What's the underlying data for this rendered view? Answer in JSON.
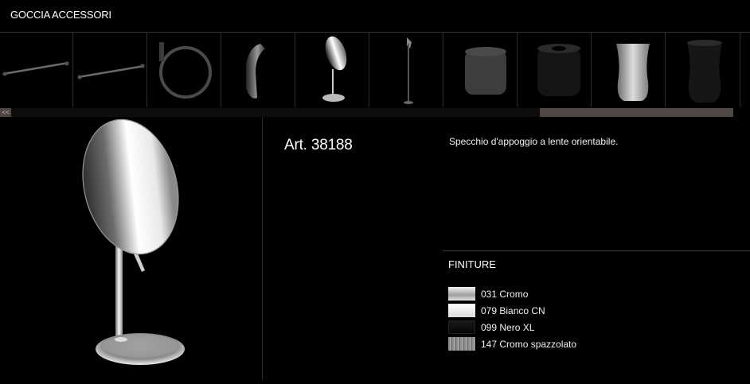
{
  "page": {
    "title": "GOCCIA ACCESSORI"
  },
  "thumbnails": [
    {
      "name": "towel-bar-thumbnail-1",
      "icon": "towel-bar-icon"
    },
    {
      "name": "towel-bar-thumbnail-2",
      "icon": "towel-bar-icon"
    },
    {
      "name": "towel-ring-thumbnail",
      "icon": "towel-ring-icon"
    },
    {
      "name": "robe-hook-thumbnail",
      "icon": "robe-hook-icon"
    },
    {
      "name": "standing-mirror-thumbnail",
      "icon": "standing-mirror-icon"
    },
    {
      "name": "floor-stand-thumbnail",
      "icon": "floor-stand-icon"
    },
    {
      "name": "grey-canister-thumbnail",
      "icon": "canister-icon"
    },
    {
      "name": "black-canister-thumbnail",
      "icon": "canister-icon"
    },
    {
      "name": "white-tumbler-thumbnail",
      "icon": "tumbler-icon"
    },
    {
      "name": "black-tumbler-thumbnail",
      "icon": "tumbler-icon"
    }
  ],
  "scroll": {
    "left_label": "<<"
  },
  "product": {
    "code": "Art. 38188",
    "description": "Specchio d'appoggio a lente orientabile."
  },
  "finishes": {
    "title": "FINITURE",
    "items": [
      {
        "label": "031 Cromo",
        "color": "#d8d8d8"
      },
      {
        "label": "079 Bianco CN",
        "color": "#f4f4f4"
      },
      {
        "label": "099 Nero XL",
        "color": "#0a0a0a"
      },
      {
        "label": "147 Cromo spazzolato",
        "color": "#9a9a9a"
      }
    ]
  }
}
